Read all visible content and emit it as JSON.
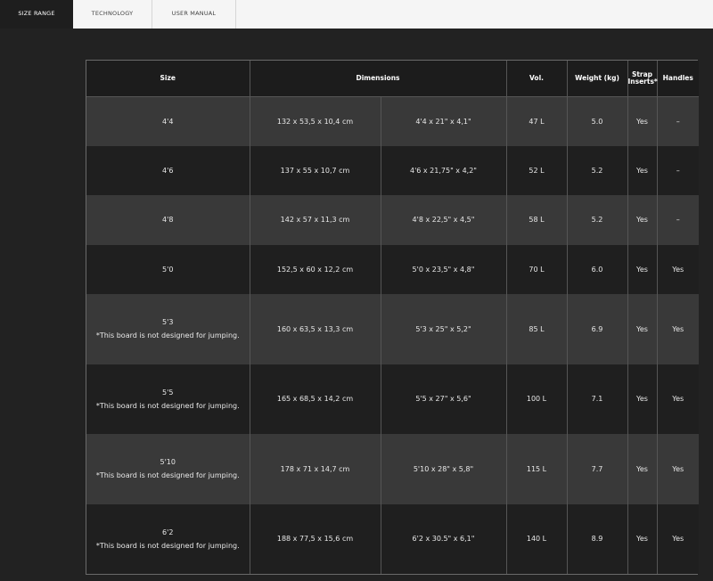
{
  "tabs": [
    {
      "label": "SIZE RANGE",
      "active": true
    },
    {
      "label": "TECHNOLOGY",
      "active": false
    },
    {
      "label": "USER MANUAL",
      "active": false
    }
  ],
  "table": {
    "headers": {
      "size": "Size",
      "dimensions": "Dimensions",
      "vol": "Vol.",
      "weight": "Weight (kg)",
      "strap": "Strap Inserts*",
      "handles": "Handles"
    },
    "rows": [
      {
        "size": "4'4",
        "note": "",
        "metric": "132 x 53,5 x 10,4 cm",
        "imperial": "4'4 x 21\" x 4,1\"",
        "vol": "47 L",
        "weight": "5.0",
        "strap": "Yes",
        "handles": "–"
      },
      {
        "size": "4'6",
        "note": "",
        "metric": "137 x 55 x 10,7 cm",
        "imperial": "4'6 x 21,75\" x 4,2\"",
        "vol": "52 L",
        "weight": "5.2",
        "strap": "Yes",
        "handles": "–"
      },
      {
        "size": "4'8",
        "note": "",
        "metric": "142 x 57 x 11,3 cm",
        "imperial": "4'8 x 22,5\" x 4,5\"",
        "vol": "58 L",
        "weight": "5.2",
        "strap": "Yes",
        "handles": "–"
      },
      {
        "size": "5'0",
        "note": "",
        "metric": "152,5 x 60 x 12,2 cm",
        "imperial": "5'0 x 23,5\" x 4,8\"",
        "vol": "70 L",
        "weight": "6.0",
        "strap": "Yes",
        "handles": "Yes"
      },
      {
        "size": "5'3",
        "note": "*This board is not designed for jumping.",
        "metric": "160 x 63,5 x 13,3 cm",
        "imperial": "5'3 x 25\" x 5,2\"",
        "vol": "85 L",
        "weight": "6.9",
        "strap": "Yes",
        "handles": "Yes"
      },
      {
        "size": "5'5",
        "note": "*This board is not designed for jumping.",
        "metric": "165 x 68,5 x 14,2 cm",
        "imperial": "5'5 x 27\" x 5,6\"",
        "vol": "100 L",
        "weight": "7.1",
        "strap": "Yes",
        "handles": "Yes"
      },
      {
        "size": "5'10",
        "note": "*This board is not designed for jumping.",
        "metric": "178 x 71 x 14,7 cm",
        "imperial": "5'10 x 28\" x 5,8\"",
        "vol": "115 L",
        "weight": "7.7",
        "strap": "Yes",
        "handles": "Yes"
      },
      {
        "size": "6'2",
        "note": "*This board is not designed for jumping.",
        "metric": "188 x 77,5 x 15,6 cm",
        "imperial": "6'2 x 30.5\" x 6,1\"",
        "vol": "140 L",
        "weight": "8.9",
        "strap": "Yes",
        "handles": "Yes"
      }
    ]
  }
}
